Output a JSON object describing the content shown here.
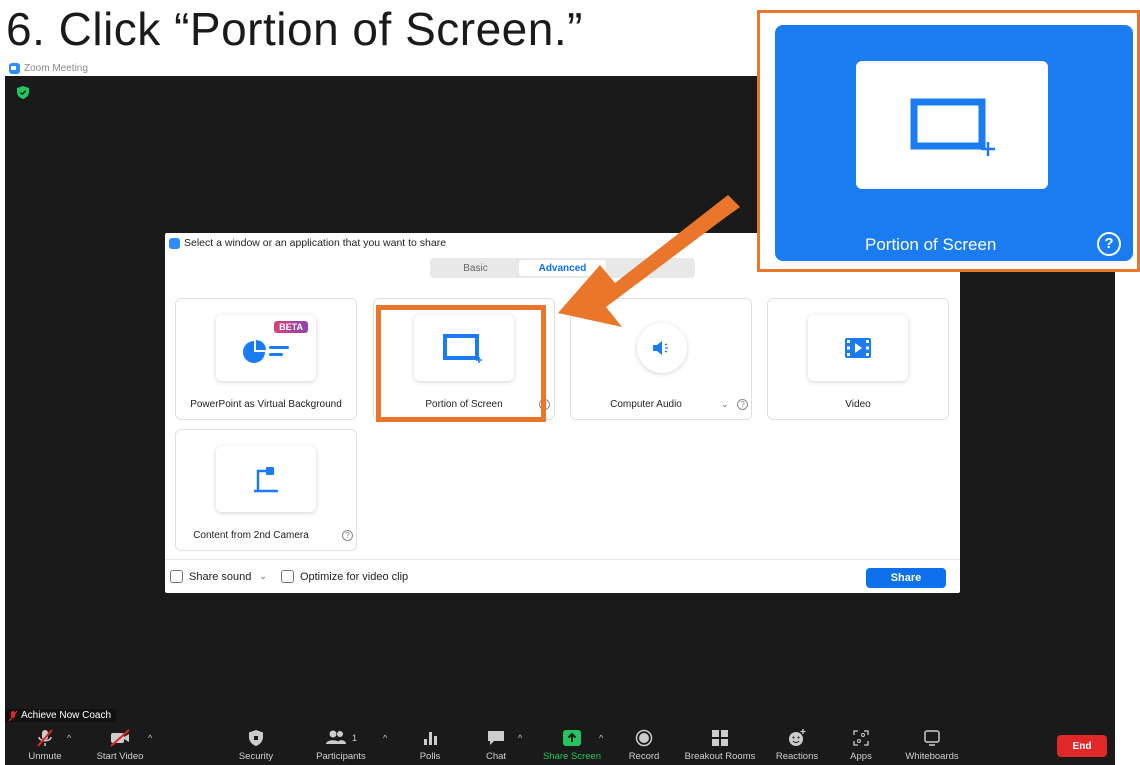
{
  "slide": {
    "title": "6. Click “Portion of Screen.”"
  },
  "window": {
    "title": "Zoom Meeting"
  },
  "dialog": {
    "header": "Select a window or an application that you want to share",
    "tabs": [
      {
        "label": "Basic",
        "active": false
      },
      {
        "label": "Advanced",
        "active": true
      }
    ],
    "options": [
      {
        "label": "PowerPoint as Virtual Background",
        "badge": "BETA",
        "icon": "powerpoint-chart-icon"
      },
      {
        "label": "Portion of Screen",
        "icon": "portion-screen-icon"
      },
      {
        "label": "Computer Audio",
        "icon": "speaker-icon"
      },
      {
        "label": "Video",
        "icon": "film-icon"
      },
      {
        "label": "Content from 2nd Camera",
        "icon": "document-camera-icon"
      }
    ],
    "footer": {
      "share_sound": "Share sound",
      "optimize": "Optimize for video clip",
      "share_button": "Share"
    }
  },
  "callout": {
    "label": "Portion of Screen"
  },
  "host": {
    "name": "Achieve Now Coach"
  },
  "toolbar": {
    "items": [
      {
        "label": "Unmute",
        "icon": "muted-mic-icon"
      },
      {
        "label": "Start Video",
        "icon": "video-off-icon"
      },
      {
        "label": "Security",
        "icon": "shield-icon"
      },
      {
        "label": "Participants",
        "icon": "participants-icon",
        "count": "1"
      },
      {
        "label": "Polls",
        "icon": "polls-icon"
      },
      {
        "label": "Chat",
        "icon": "chat-icon"
      },
      {
        "label": "Share Screen",
        "icon": "share-screen-icon"
      },
      {
        "label": "Record",
        "icon": "record-icon"
      },
      {
        "label": "Breakout Rooms",
        "icon": "breakout-rooms-icon"
      },
      {
        "label": "Reactions",
        "icon": "reactions-icon"
      },
      {
        "label": "Apps",
        "icon": "apps-icon"
      },
      {
        "label": "Whiteboards",
        "icon": "whiteboard-icon"
      }
    ],
    "end_label": "End"
  },
  "colors": {
    "accent": "#0e71eb",
    "highlight": "#e9762b",
    "end": "#e02828",
    "share_green": "#22c55e"
  }
}
